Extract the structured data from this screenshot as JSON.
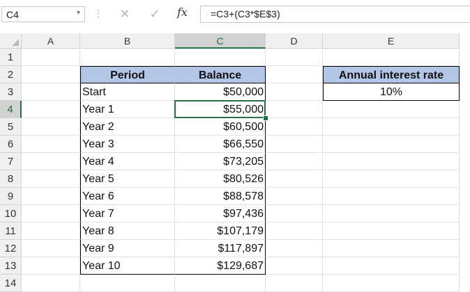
{
  "name_box": {
    "value": "C4"
  },
  "formula_bar": {
    "cancel_glyph": "✕",
    "enter_glyph": "✓",
    "fx_label": "fx",
    "formula": "=C3+(C3*$E$3)"
  },
  "columns": [
    "A",
    "B",
    "C",
    "D",
    "E"
  ],
  "selected_column": "C",
  "rows": [
    "1",
    "2",
    "3",
    "4",
    "5",
    "6",
    "7",
    "8",
    "9",
    "10",
    "11",
    "12",
    "13",
    "14"
  ],
  "selected_row": "4",
  "table": {
    "header_period": "Period",
    "header_balance": "Balance",
    "rows": [
      {
        "period": "Start",
        "balance": "$50,000"
      },
      {
        "period": "Year 1",
        "balance": "$55,000"
      },
      {
        "period": "Year 2",
        "balance": "$60,500"
      },
      {
        "period": "Year 3",
        "balance": "$66,550"
      },
      {
        "period": "Year 4",
        "balance": "$73,205"
      },
      {
        "period": "Year 5",
        "balance": "$80,526"
      },
      {
        "period": "Year 6",
        "balance": "$88,578"
      },
      {
        "period": "Year 7",
        "balance": "$97,436"
      },
      {
        "period": "Year 8",
        "balance": "$107,179"
      },
      {
        "period": "Year 9",
        "balance": "$117,897"
      },
      {
        "period": "Year 10",
        "balance": "$129,687"
      }
    ]
  },
  "rate": {
    "header": "Annual interest rate",
    "value": "10%"
  },
  "colors": {
    "header_fill": "#b4c6e7",
    "selection": "#217346"
  }
}
